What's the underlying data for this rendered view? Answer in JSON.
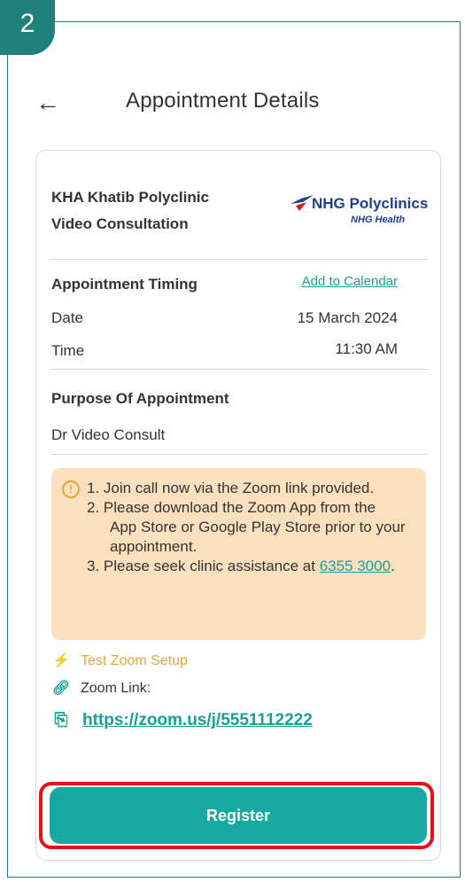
{
  "step_badge": "2",
  "header": {
    "back_icon": "arrow-left-icon",
    "title": "Appointment Details"
  },
  "clinic": {
    "name_line1": "KHA Khatib Polyclinic",
    "name_line2": "Video Consultation"
  },
  "logo": {
    "main": "NHG Polyclinics",
    "sub": "NHG Health"
  },
  "timing": {
    "heading": "Appointment Timing",
    "add_calendar": "Add to Calendar",
    "date_label": "Date",
    "date_value": "15 March 2024",
    "time_label": "Time",
    "time_value": "11:30 AM"
  },
  "purpose": {
    "heading": "Purpose Of Appointment",
    "value": "Dr Video Consult"
  },
  "notice": {
    "icon": "info-icon",
    "item1": "1. Join call now via the Zoom link provided.",
    "item2": "2. Please download the Zoom App from the App Store or Google Play Store prior to your appointment.",
    "item3_prefix": "3. Please seek clinic assistance at ",
    "phone": "6355 3000",
    "item3_suffix": "."
  },
  "zoom": {
    "test_label": "Test Zoom Setup",
    "link_label": "Zoom Link:",
    "url": "https://zoom.us/j/5551112222"
  },
  "register_label": "Register",
  "colors": {
    "accent": "#1aa9a2",
    "frame": "#1f7f7b",
    "notice_bg": "#fae0bf",
    "highlight": "#e0121a"
  }
}
